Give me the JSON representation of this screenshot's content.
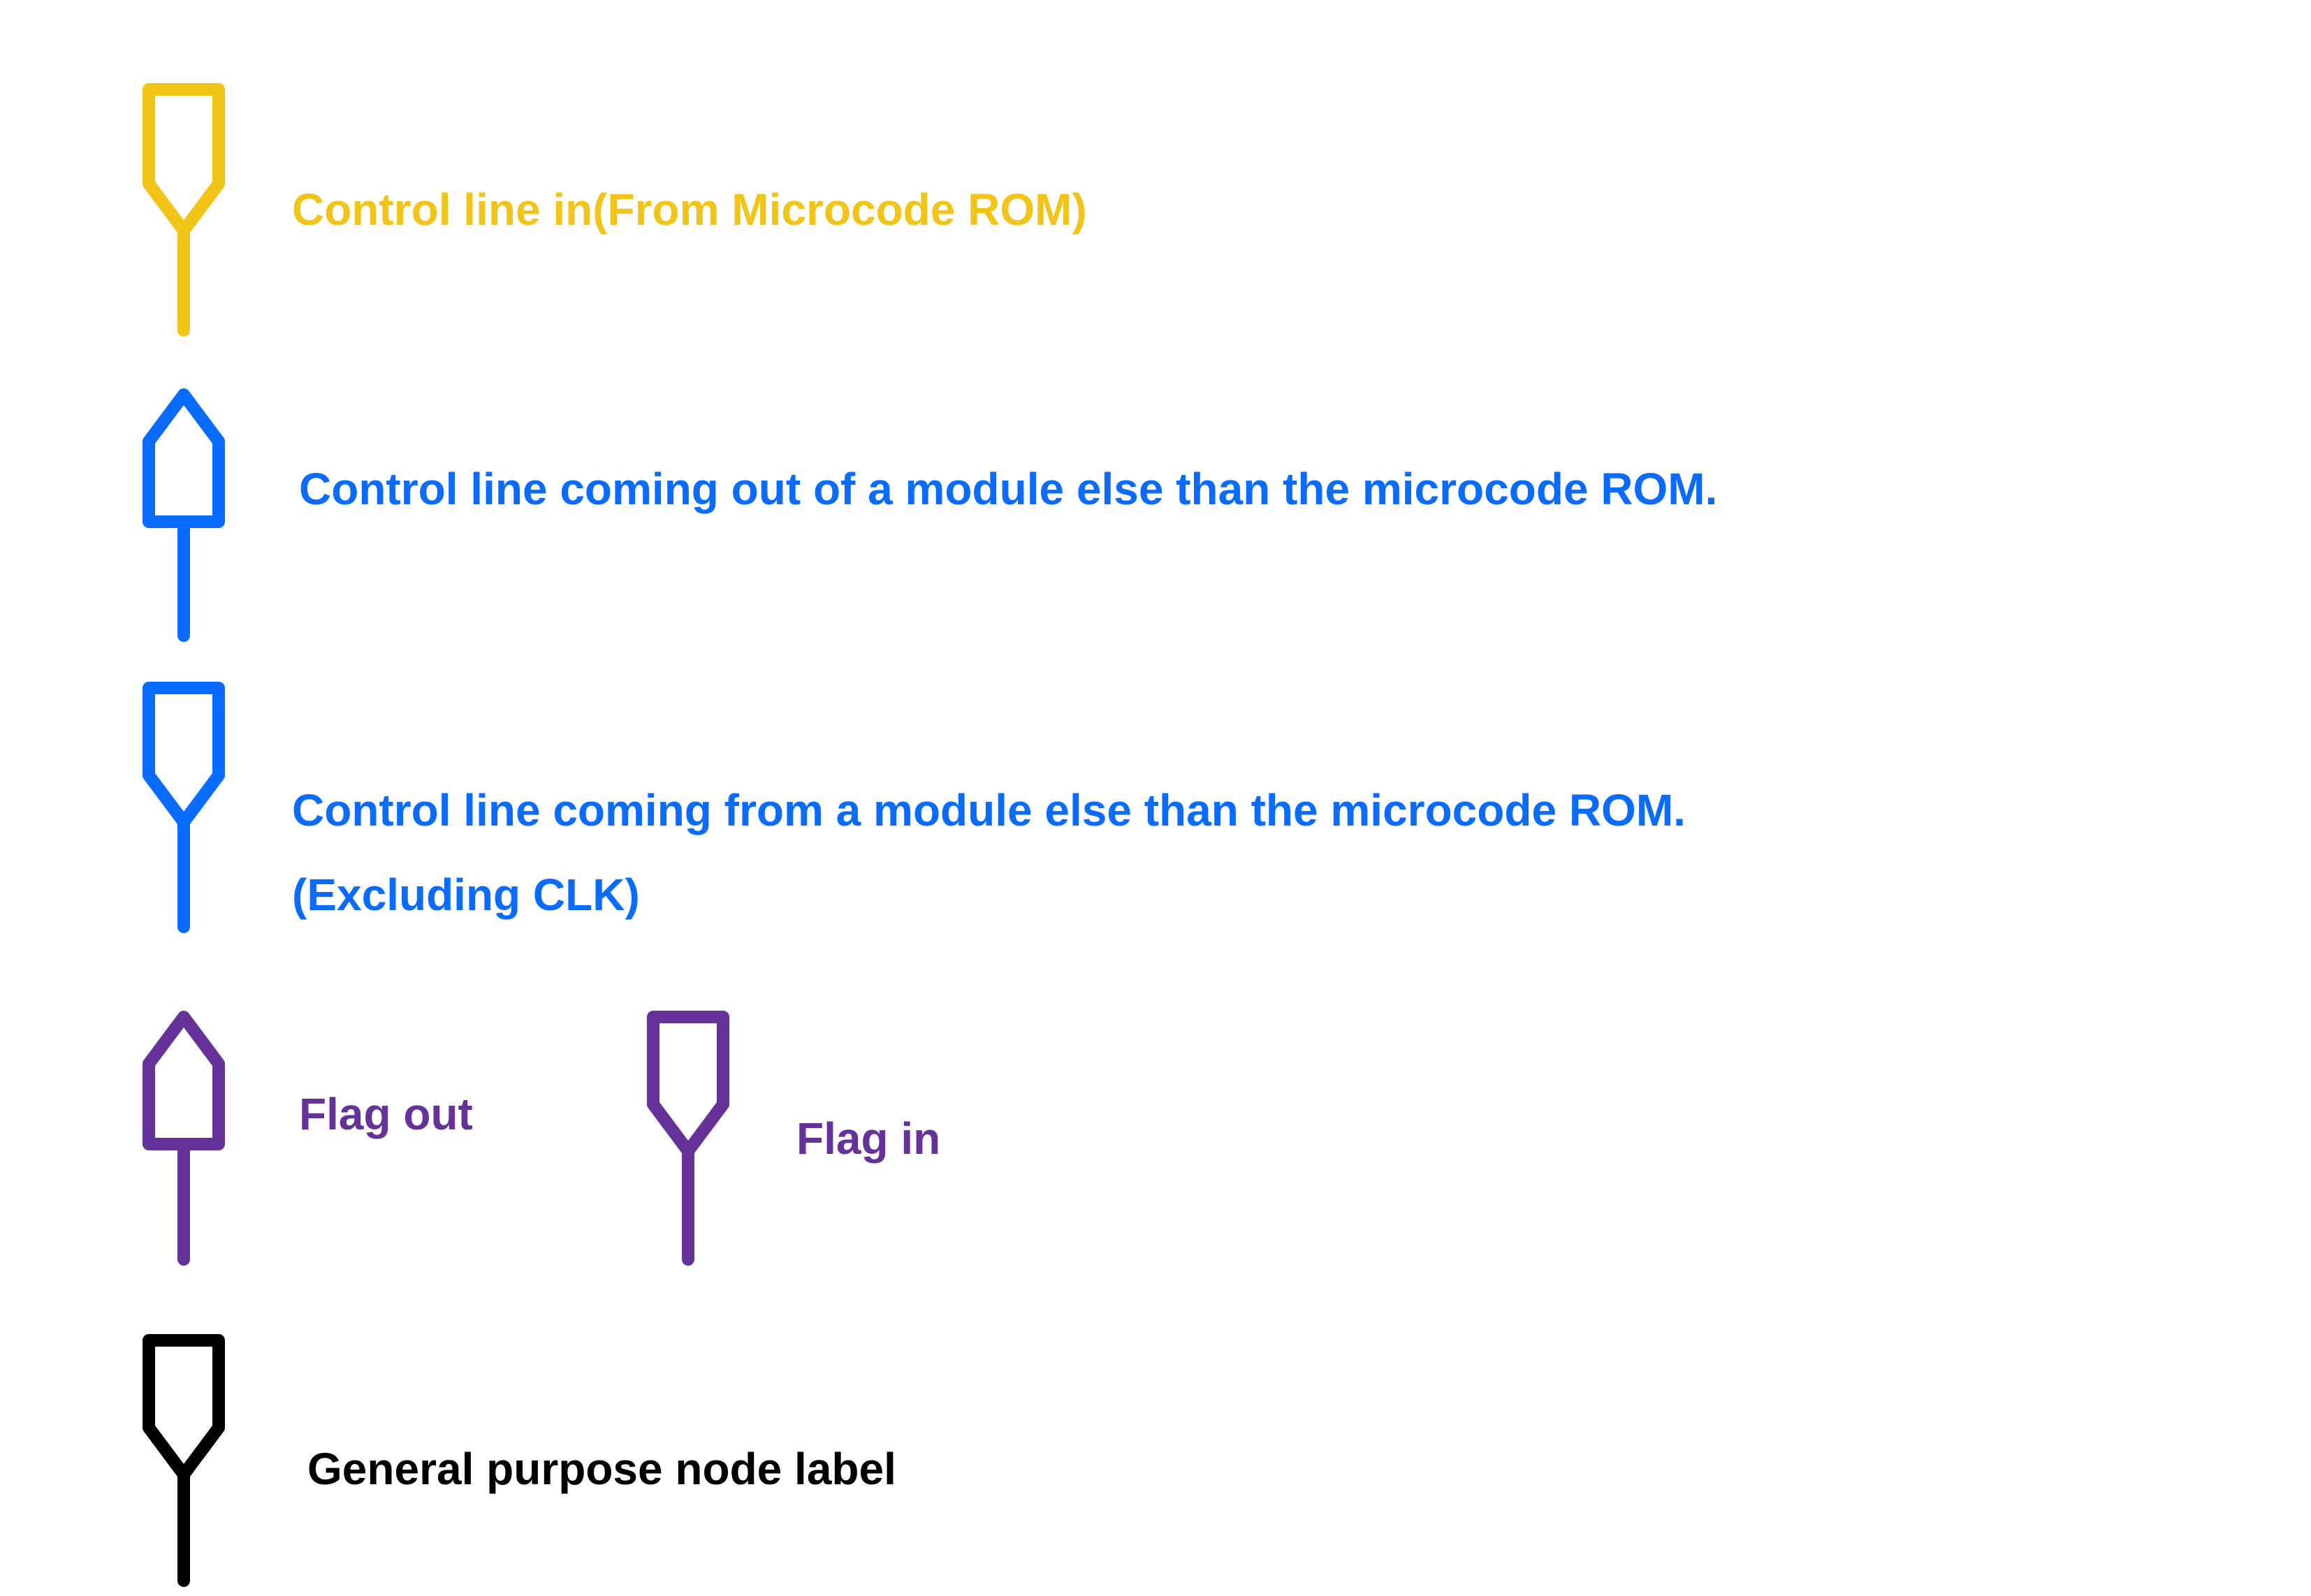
{
  "colors": {
    "microcode": "#f2c418",
    "module": "#0a6cff",
    "flag": "#65329a",
    "general": "#000000"
  },
  "legend": {
    "microcode_in": {
      "icon": "node-label-in-icon",
      "label": "Control line in(From Microcode ROM)"
    },
    "module_out": {
      "icon": "node-label-out-icon",
      "label": "Control line coming out of a module else than the microcode ROM."
    },
    "module_in": {
      "icon": "node-label-in-icon",
      "label_line1": "Control line coming from a module else than the microcode ROM.",
      "label_line2": "(Excluding CLK)"
    },
    "flag_out": {
      "icon": "node-label-out-icon",
      "label": "Flag out"
    },
    "flag_in": {
      "icon": "node-label-in-icon",
      "label": "Flag in"
    },
    "general": {
      "icon": "node-label-in-icon",
      "label": "General purpose node label"
    }
  }
}
